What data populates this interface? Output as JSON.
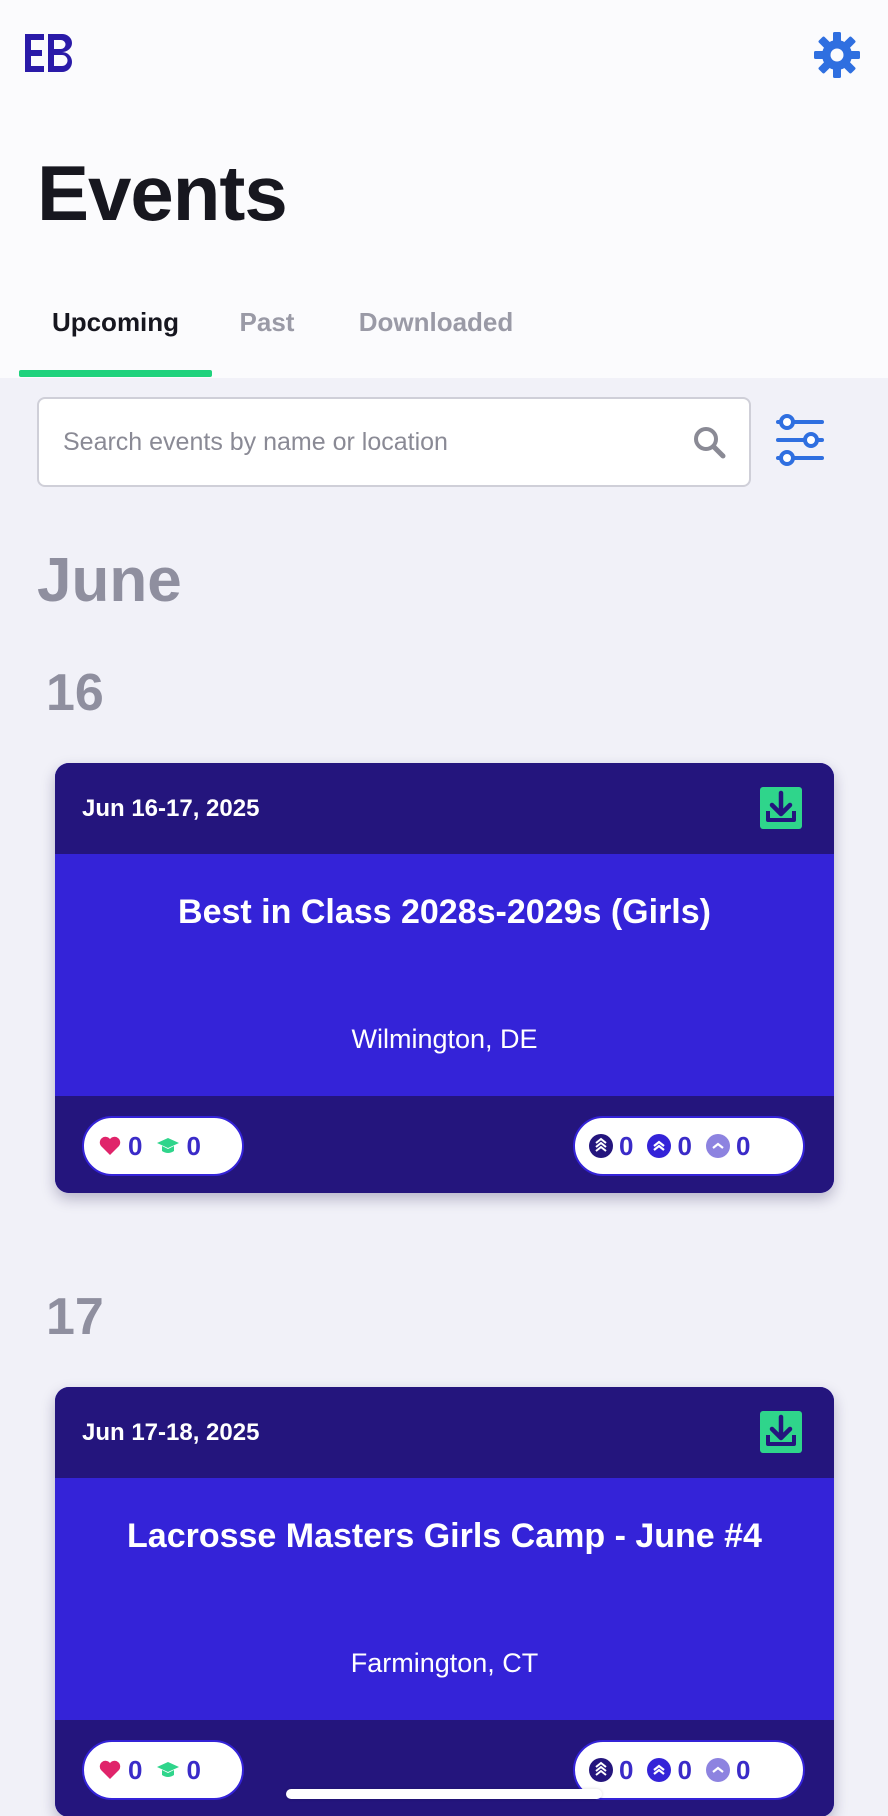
{
  "app": {
    "title": "Events",
    "logo_text": "EB"
  },
  "tabs": [
    {
      "label": "Upcoming",
      "active": true
    },
    {
      "label": "Past",
      "active": false
    },
    {
      "label": "Downloaded",
      "active": false
    }
  ],
  "search": {
    "placeholder": "Search events by name or location",
    "value": ""
  },
  "icons": {
    "settings": "gear-icon",
    "search": "search-icon",
    "filter": "sliders-icon",
    "download": "download-icon",
    "favorite": "heart-icon",
    "college": "graduation-cap-icon",
    "level_triple": "triple-chevron-icon",
    "level_double": "double-chevron-icon",
    "level_single": "single-chevron-icon"
  },
  "colors": {
    "accent_green": "#1fd27d",
    "card_dark": "#24157d",
    "card_primary": "#3423d8",
    "link_blue": "#2f6fe0"
  },
  "month": "June",
  "groups": [
    {
      "day": "16",
      "event": {
        "date": "Jun 16-17, 2025",
        "title": "Best in Class 2028s-2029s (Girls)",
        "location": "Wilmington, DE",
        "favorites": "0",
        "college": "0",
        "level_triple": "0",
        "level_double": "0",
        "level_single": "0"
      }
    },
    {
      "day": "17",
      "event": {
        "date": "Jun 17-18, 2025",
        "title": "Lacrosse Masters Girls Camp - June #4",
        "location": "Farmington, CT",
        "favorites": "0",
        "college": "0",
        "level_triple": "0",
        "level_double": "0",
        "level_single": "0"
      }
    }
  ]
}
